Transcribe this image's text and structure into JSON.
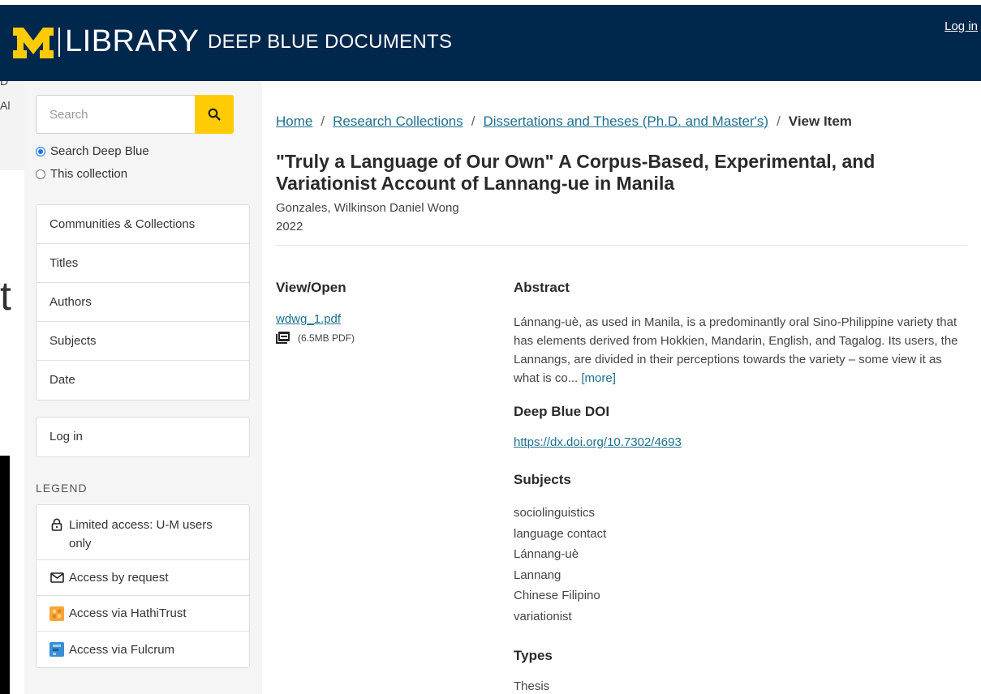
{
  "header": {
    "logo_m": "M",
    "logo_library": "LIBRARY",
    "site_name": "DEEP BLUE DOCUMENTS",
    "login": "Log in",
    "bg_color": "#00274c",
    "accent_color": "#ffcb05"
  },
  "bleed": {
    "g1": "D",
    "g2": "Al",
    "g3": "t"
  },
  "sidebar": {
    "search_placeholder": "Search",
    "scope": [
      {
        "label": "Search Deep Blue",
        "selected": true
      },
      {
        "label": "This collection",
        "selected": false
      }
    ],
    "browse": [
      "Communities & Collections",
      "Titles",
      "Authors",
      "Subjects",
      "Date"
    ],
    "login": "Log in",
    "legend_title": "LEGEND",
    "legend": [
      {
        "icon": "lock-icon",
        "label": "Limited access: U-M users only"
      },
      {
        "icon": "envelope-icon",
        "label": "Access by request"
      },
      {
        "icon": "hathitrust-icon",
        "label": "Access via HathiTrust"
      },
      {
        "icon": "fulcrum-icon",
        "label": "Access via Fulcrum"
      }
    ]
  },
  "breadcrumb": {
    "home": "Home",
    "research": "Research Collections",
    "dissertations": "Dissertations and Theses (Ph.D. and Master's)",
    "current": "View Item",
    "sep": "/"
  },
  "item": {
    "title": "\"Truly a Language of Our Own\" A Corpus-Based, Experimental, and Variationist Account of Lannang-ue in Manila",
    "author": "Gonzales, Wilkinson Daniel Wong",
    "year": "2022"
  },
  "view_open": {
    "heading": "View/Open",
    "file_name": "wdwg_1.pdf",
    "file_meta": "(6.5MB  PDF)"
  },
  "abstract": {
    "heading": "Abstract",
    "text": "Lánnang-uè, as used in Manila, is a predominantly oral Sino-Philippine variety that has elements derived from Hokkien, Mandarin, English, and Tagalog. Its users, the Lannangs, are divided in their perceptions towards the variety – some view it as what is co...",
    "more": "[more]"
  },
  "doi": {
    "heading": "Deep Blue DOI",
    "url": "https://dx.doi.org/10.7302/4693"
  },
  "subjects": {
    "heading": "Subjects",
    "items": [
      "sociolinguistics",
      "language contact",
      "Lánnang-uè",
      "Lannang",
      "Chinese Filipino",
      "variationist"
    ]
  },
  "types": {
    "heading": "Types",
    "items": [
      "Thesis"
    ]
  }
}
